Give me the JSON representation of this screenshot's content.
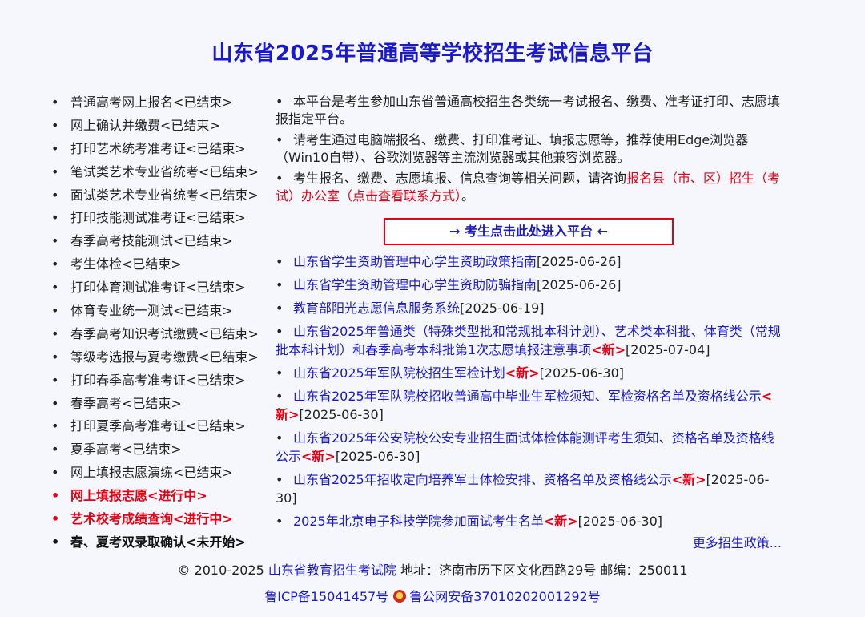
{
  "title": "山东省2025年普通高等学校招生考试信息平台",
  "menu": [
    {
      "label": "普通高考网上报名<已结束>",
      "state": "ended"
    },
    {
      "label": "网上确认并缴费<已结束>",
      "state": "ended"
    },
    {
      "label": "打印艺术统考准考证<已结束>",
      "state": "ended"
    },
    {
      "label": "笔试类艺术专业省统考<已结束>",
      "state": "ended"
    },
    {
      "label": "面试类艺术专业省统考<已结束>",
      "state": "ended"
    },
    {
      "label": "打印技能测试准考证<已结束>",
      "state": "ended"
    },
    {
      "label": "春季高考技能测试<已结束>",
      "state": "ended"
    },
    {
      "label": "考生体检<已结束>",
      "state": "ended"
    },
    {
      "label": "打印体育测试准考证<已结束>",
      "state": "ended"
    },
    {
      "label": "体育专业统一测试<已结束>",
      "state": "ended"
    },
    {
      "label": "春季高考知识考试缴费<已结束>",
      "state": "ended"
    },
    {
      "label": "等级考选报与夏考缴费<已结束>",
      "state": "ended"
    },
    {
      "label": "打印春季高考准考证<已结束>",
      "state": "ended"
    },
    {
      "label": "春季高考<已结束>",
      "state": "ended"
    },
    {
      "label": "打印夏季高考准考证<已结束>",
      "state": "ended"
    },
    {
      "label": "夏季高考<已结束>",
      "state": "ended"
    },
    {
      "label": "网上填报志愿演练<已结束>",
      "state": "ended"
    },
    {
      "label": "网上填报志愿<进行中>",
      "state": "active"
    },
    {
      "label": "艺术校考成绩查询<进行中>",
      "state": "active"
    },
    {
      "label": "春、夏考双录取确认<未开始>",
      "state": "pending"
    }
  ],
  "intro": {
    "p1": "本平台是考生参加山东省普通高校招生各类统一考试报名、缴费、准考证打印、志愿填报指定平台。",
    "p2": "请考生通过电脑端报名、缴费、打印准考证、填报志愿等，推荐使用Edge浏览器（Win10自带）、谷歌浏览器等主流浏览器或其他兼容浏览器。",
    "p3_pre": "考生报名、缴费、志愿填报、信息查询等相关问题，请咨询",
    "p3_link": "报名县（市、区）招生（考试）办公室（点击查看联系方式）",
    "p3_post": "。"
  },
  "enter_button": "→ 考生点击此处进入平台 ←",
  "news": [
    {
      "title": "山东省学生资助管理中心学生资助政策指南",
      "new": "",
      "date": "[2025-06-26]"
    },
    {
      "title": "山东省学生资助管理中心学生资助防骗指南",
      "new": "",
      "date": "[2025-06-26]"
    },
    {
      "title": "教育部阳光志愿信息服务系统",
      "new": "",
      "date": "[2025-06-19]"
    },
    {
      "title": "山东省2025年普通类（特殊类型批和常规批本科计划）、艺术类本科批、体育类（常规批本科计划）和春季高考本科批第1次志愿填报注意事项",
      "new": "<新>",
      "date": "[2025-07-04]"
    },
    {
      "title": "山东省2025年军队院校招生军检计划",
      "new": "<新>",
      "date": "[2025-06-30]"
    },
    {
      "title": "山东省2025年军队院校招收普通高中毕业生军检须知、军检资格名单及资格线公示",
      "new": "<新>",
      "date": "[2025-06-30]"
    },
    {
      "title": "山东省2025年公安院校公安专业招生面试体检体能测评考生须知、资格名单及资格线公示",
      "new": "<新>",
      "date": "[2025-06-30]"
    },
    {
      "title": "山东省2025年招收定向培养军士体检安排、资格名单及资格线公示",
      "new": "<新>",
      "date": "[2025-06-30]"
    },
    {
      "title": "2025年北京电子科技学院参加面试考生名单",
      "new": "<新>",
      "date": "[2025-06-30]"
    }
  ],
  "more_link": "更多招生政策...",
  "footer": {
    "copyright": "© 2010-2025",
    "org": "山东省教育招生考试院",
    "address": "地址：济南市历下区文化西路29号 邮编：250011",
    "icp": "鲁ICP备15041457号",
    "police": "鲁公网安备37010202001292号"
  },
  "colors": {
    "accent": "#1a1acc",
    "alert": "#e60012",
    "background": "#f6f7fc"
  }
}
